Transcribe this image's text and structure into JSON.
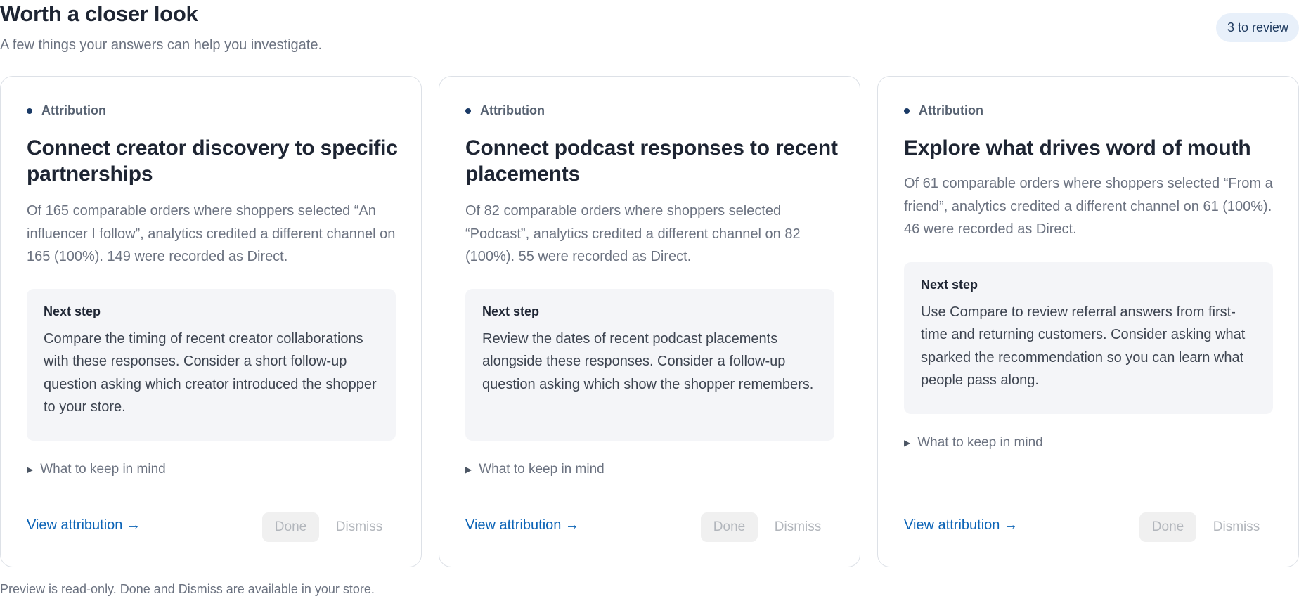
{
  "header": {
    "title": "Worth a closer look",
    "subtitle": "A few things your answers can help you investigate.",
    "badge": "3 to review"
  },
  "cards": [
    {
      "tag": "Attribution",
      "title": "Connect creator discovery to specific partnerships",
      "description": "Of 165 comparable orders where shoppers selected “An influencer I follow”, analytics credited a different channel on 165 (100%). 149 were recorded as Direct.",
      "next_step_label": "Next step",
      "next_step_text": "Compare the timing of recent creator collaborations with these responses. Consider a short follow-up question asking which creator introduced the shopper to your store.",
      "keep_in_mind": "What to keep in mind",
      "link": "View attribution →",
      "done": "Done",
      "dismiss": "Dismiss"
    },
    {
      "tag": "Attribution",
      "title": "Connect podcast responses to recent placements",
      "description": "Of 82 comparable orders where shoppers selected “Podcast”, analytics credited a different channel on 82 (100%). 55 were recorded as Direct.",
      "next_step_label": "Next step",
      "next_step_text": "Review the dates of recent podcast placements alongside these responses. Consider a follow-up question asking which show the shopper remembers.",
      "keep_in_mind": "What to keep in mind",
      "link": "View attribution →",
      "done": "Done",
      "dismiss": "Dismiss"
    },
    {
      "tag": "Attribution",
      "title": "Explore what drives word of mouth",
      "description": "Of 61 comparable orders where shoppers selected “From a friend”, analytics credited a different channel on 61 (100%). 46 were recorded as Direct.",
      "next_step_label": "Next step",
      "next_step_text": "Use Compare to review referral answers from first-time and returning customers. Consider asking what sparked the recommendation so you can learn what people pass along.",
      "keep_in_mind": "What to keep in mind",
      "link": "View attribution →",
      "done": "Done",
      "dismiss": "Dismiss"
    }
  ],
  "footer": {
    "note": "Preview is read-only. Done and Dismiss are available in your store."
  },
  "icons": {
    "tag_dot": "bullet-dot-icon",
    "disclosure": "triangle-right-icon"
  },
  "colors": {
    "accent_link": "#0b63b6",
    "badge_bg": "#e8f0fa",
    "tag_dot": "#1a3a66"
  }
}
